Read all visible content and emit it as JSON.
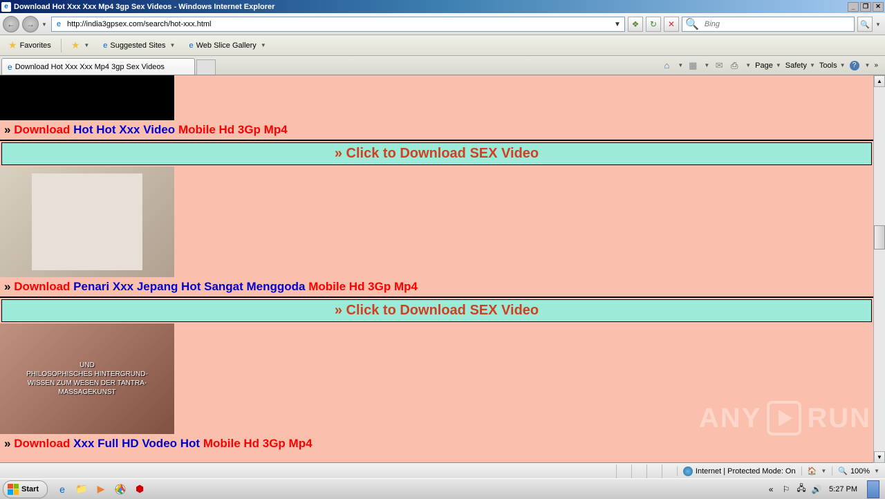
{
  "titlebar": {
    "title": "Download Hot Xxx Xxx Mp4 3gp Sex Videos - Windows Internet Explorer"
  },
  "nav": {
    "url": "http://india3gpsex.com/search/hot-xxx.html",
    "search_placeholder": "Bing"
  },
  "favbar": {
    "favorites": "Favorites",
    "suggested": "Suggested Sites",
    "webslice": "Web Slice Gallery"
  },
  "tab": {
    "title": "Download Hot Xxx Xxx Mp4 3gp Sex Videos"
  },
  "cmdbar": {
    "page": "Page",
    "safety": "Safety",
    "tools": "Tools"
  },
  "content": {
    "items": [
      {
        "download": "Download",
        "title": "Hot Hot Xxx Video",
        "suffix": "Mobile Hd 3Gp Mp4"
      },
      {
        "download": "Download",
        "title": "Penari Xxx Jepang Hot Sangat Menggoda",
        "suffix": "Mobile Hd 3Gp Mp4"
      },
      {
        "download": "Download",
        "title": "Xxx Full HD Vodeo Hot",
        "suffix": "Mobile Hd 3Gp Mp4"
      }
    ],
    "click_bar": "» Click to Download SEX Video",
    "thumb3_line1": "UND",
    "thumb3_line2": "PHILOSOPHISCHES HINTERGRUND-",
    "thumb3_line3": "WISSEN ZUM WESEN DER TANTRA-",
    "thumb3_line4": "MASSAGEKUNST"
  },
  "statusbar": {
    "zone": "Internet | Protected Mode: On",
    "zoom": "100%"
  },
  "taskbar": {
    "start": "Start",
    "time": "5:27 PM"
  },
  "watermark": {
    "left": "ANY",
    "right": "RUN"
  }
}
